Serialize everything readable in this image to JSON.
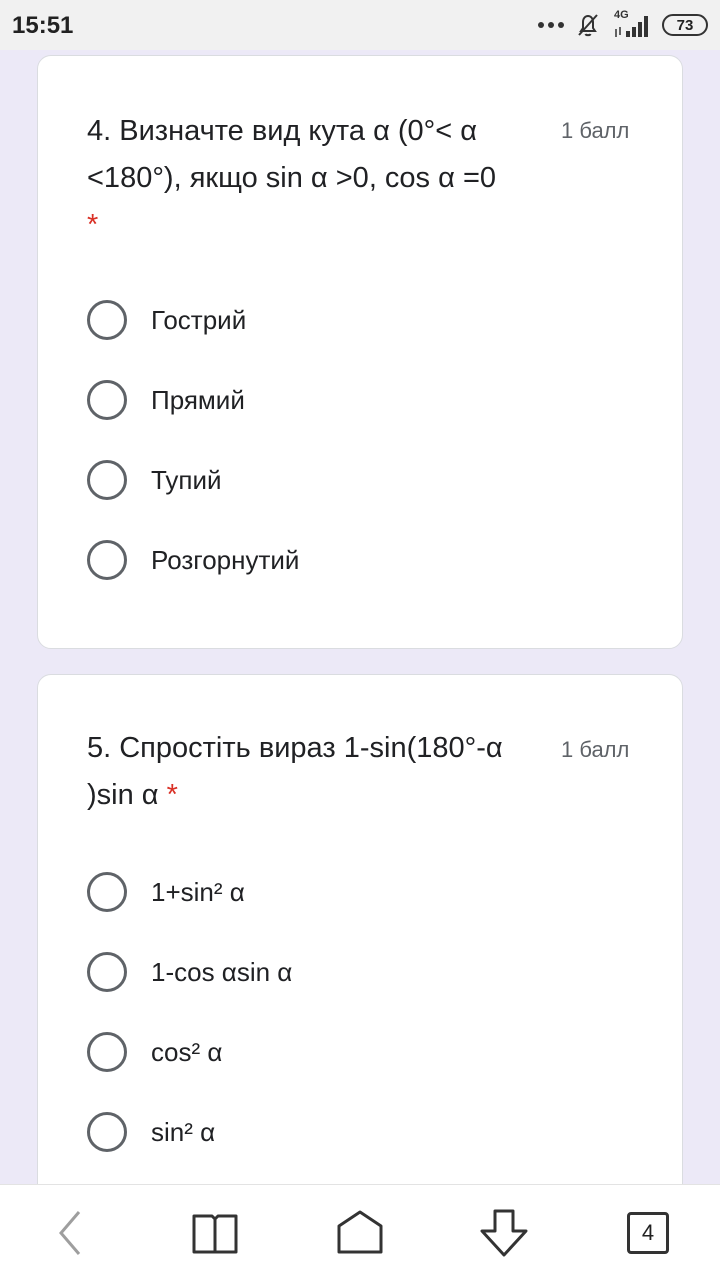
{
  "status_bar": {
    "time": "15:51",
    "network_label": "4G",
    "battery_level": "73",
    "icons": [
      "more-dots-icon",
      "bell-off-icon",
      "signal-icon",
      "battery-icon"
    ]
  },
  "questions": [
    {
      "title": "4. Визначте вид кута  α (0°< α <180°), якщо sin α >0, cos α =0",
      "required_mark": "*",
      "points": "1 балл",
      "options": [
        "Гострий",
        "Прямий",
        "Тупий",
        "Розгорнутий"
      ]
    },
    {
      "title": "5. Спростіть вираз 1-sin(180°-α )sin α",
      "required_mark": "*",
      "points": "1 балл",
      "options": [
        "1+sin² α",
        "1-cos αsin α",
        "cos² α",
        "sin² α"
      ]
    }
  ],
  "bottom_nav": {
    "tab_count": "4",
    "icons": [
      "back-icon",
      "bookmarks-icon",
      "home-icon",
      "download-icon",
      "tabs-icon"
    ]
  },
  "colors": {
    "page_background": "#ece9f7",
    "card_background": "#ffffff",
    "required_star": "#d93025",
    "points_text": "#5f6368"
  }
}
